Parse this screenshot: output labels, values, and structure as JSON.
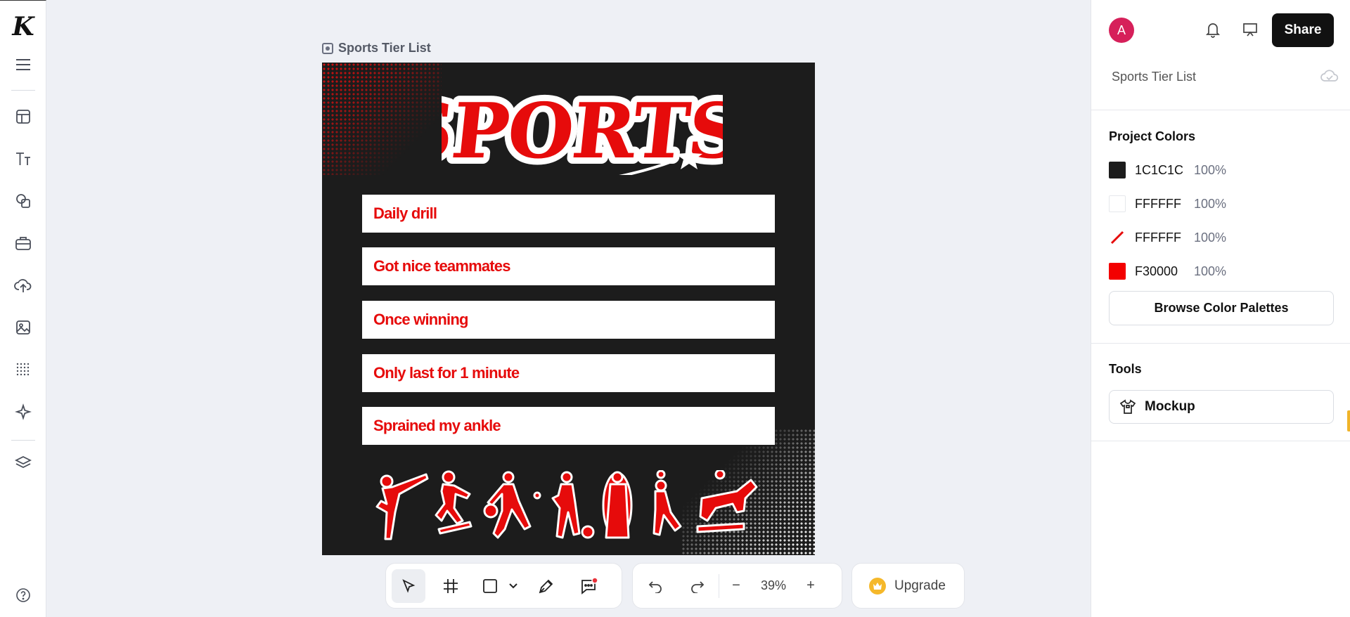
{
  "app": {
    "logo": "K"
  },
  "canvas": {
    "title": "Sports Tier List",
    "heading": "SPORTS",
    "tiers": [
      "Daily drill",
      "Got nice teammates",
      "Once winning",
      "Only last for 1 minute",
      "Sprained my ankle"
    ]
  },
  "toolbar": {
    "zoom": "39%",
    "zoom_out": "−",
    "zoom_in": "+",
    "upgrade_label": "Upgrade"
  },
  "right_panel": {
    "avatar_initial": "A",
    "share_label": "Share",
    "project_name": "Sports Tier List",
    "project_colors_title": "Project Colors",
    "colors": [
      {
        "hex": "1C1C1C",
        "opacity": "100%",
        "swatch": "#1c1c1c",
        "kind": "solid"
      },
      {
        "hex": "FFFFFF",
        "opacity": "100%",
        "swatch": "#ffffff",
        "kind": "solid"
      },
      {
        "hex": "FFFFFF",
        "opacity": "100%",
        "swatch": "#ffffff",
        "kind": "stroke"
      },
      {
        "hex": "F30000",
        "opacity": "100%",
        "swatch": "#f30000",
        "kind": "solid"
      }
    ],
    "browse_label": "Browse Color Palettes",
    "tools_title": "Tools",
    "mockup_label": "Mockup"
  }
}
